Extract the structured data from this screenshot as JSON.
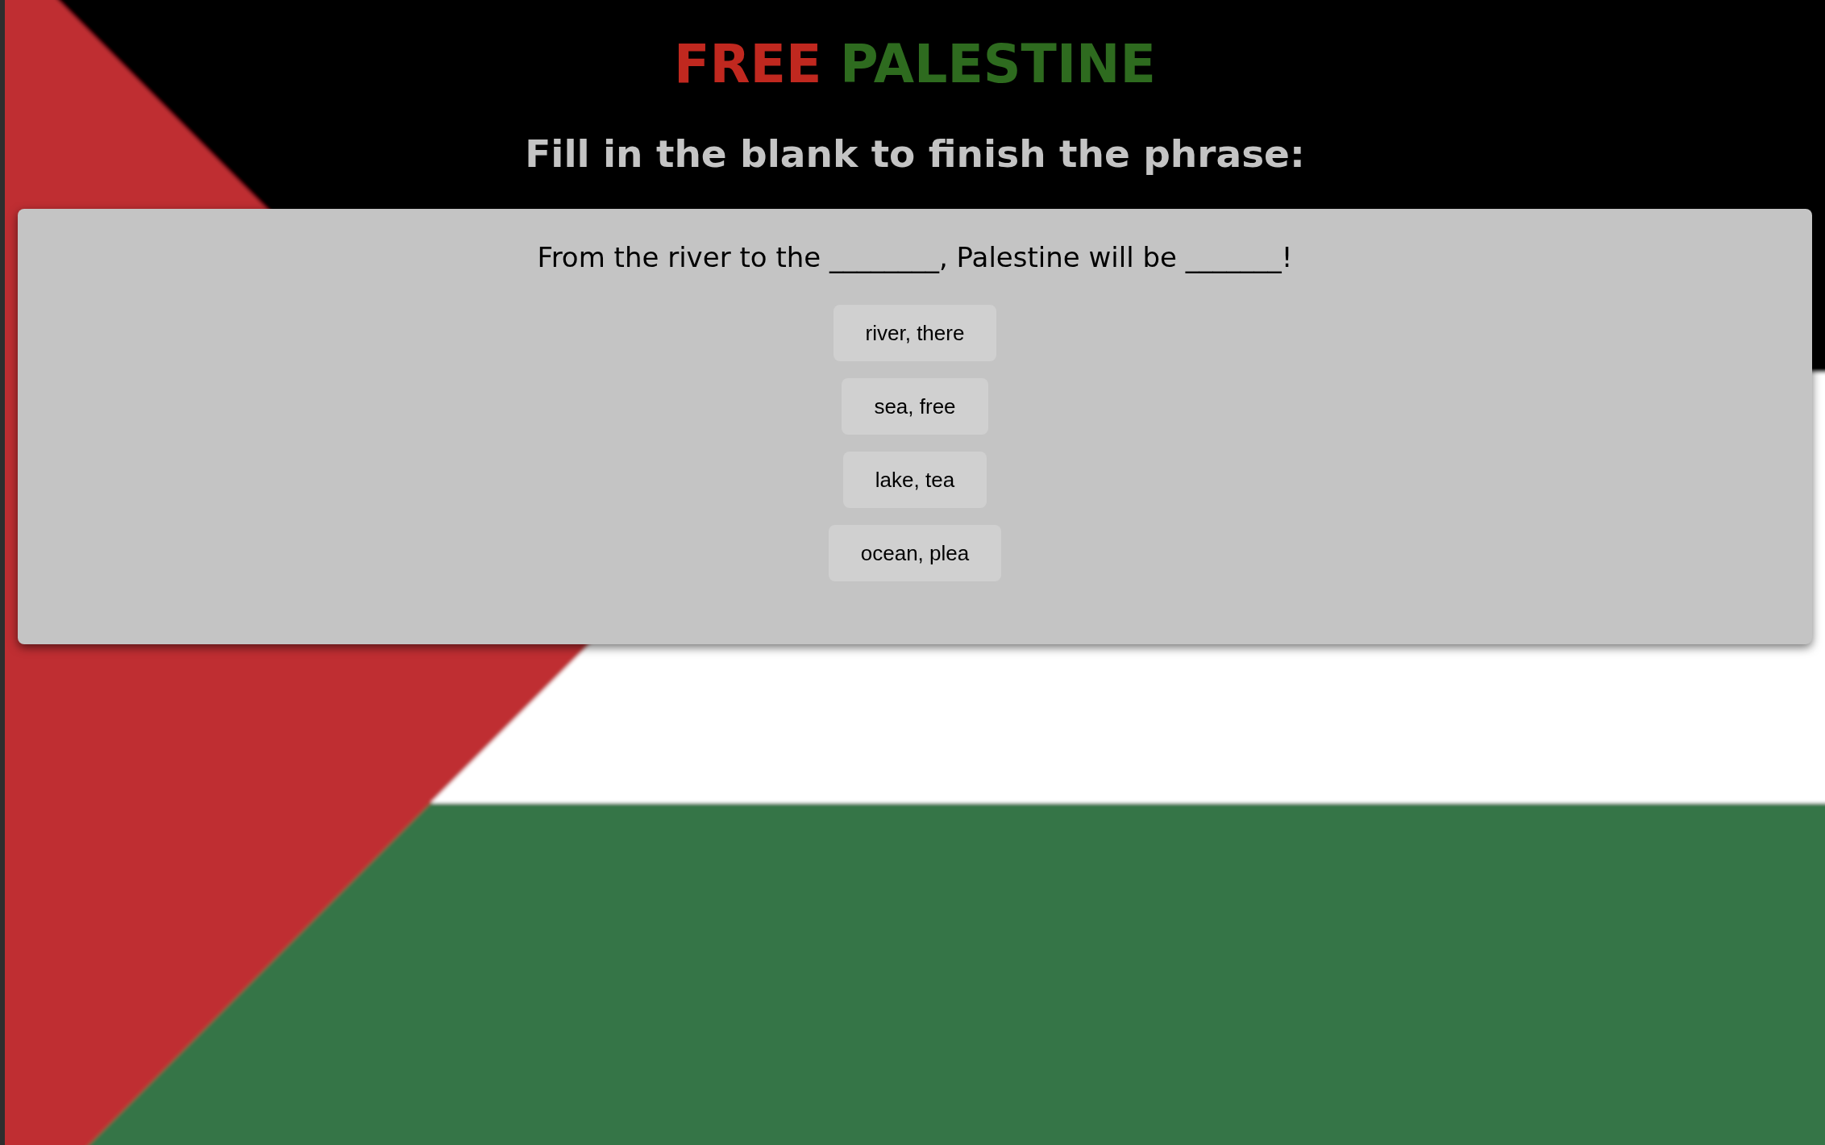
{
  "title": [
    {
      "text": "FREE",
      "color": "#c0281f"
    },
    {
      "text": "PALESTINE",
      "color": "#2e6b1f"
    }
  ],
  "subtitle": "Fill in the blank to finish the phrase:",
  "quiz": {
    "question": "From the river to the ________, Palestine will be _______!",
    "options": [
      "river, there",
      "sea, free",
      "lake, tea",
      "ocean, plea"
    ]
  }
}
